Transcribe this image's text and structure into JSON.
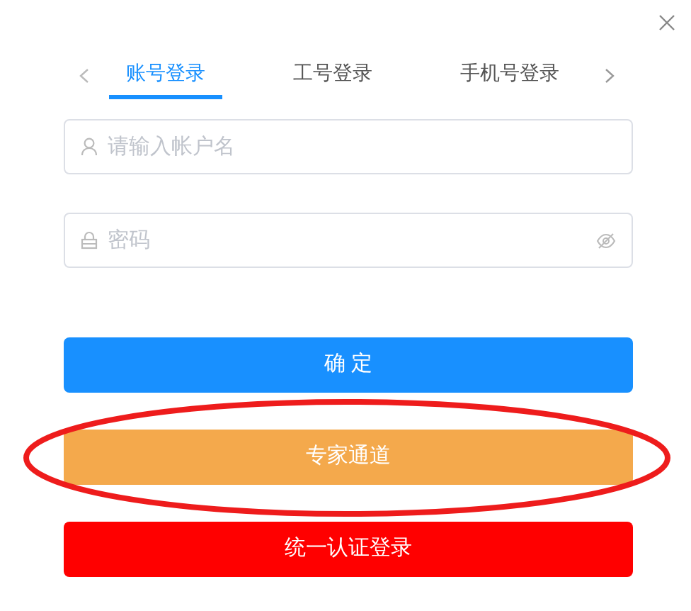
{
  "tabs": [
    {
      "label": "账号登录",
      "selected": true
    },
    {
      "label": "工号登录",
      "selected": false
    },
    {
      "label": "手机号登录",
      "selected": false
    }
  ],
  "fields": [
    {
      "kind": "user",
      "placeholder": "请输入帐户名"
    },
    {
      "kind": "password",
      "placeholder": "密码"
    }
  ],
  "buttons": [
    {
      "label": "确 定",
      "kind": "primary",
      "circled": false
    },
    {
      "label": "专家通道",
      "kind": "warning",
      "circled": true
    },
    {
      "label": "统一认证登录",
      "kind": "danger",
      "circled": false
    }
  ]
}
